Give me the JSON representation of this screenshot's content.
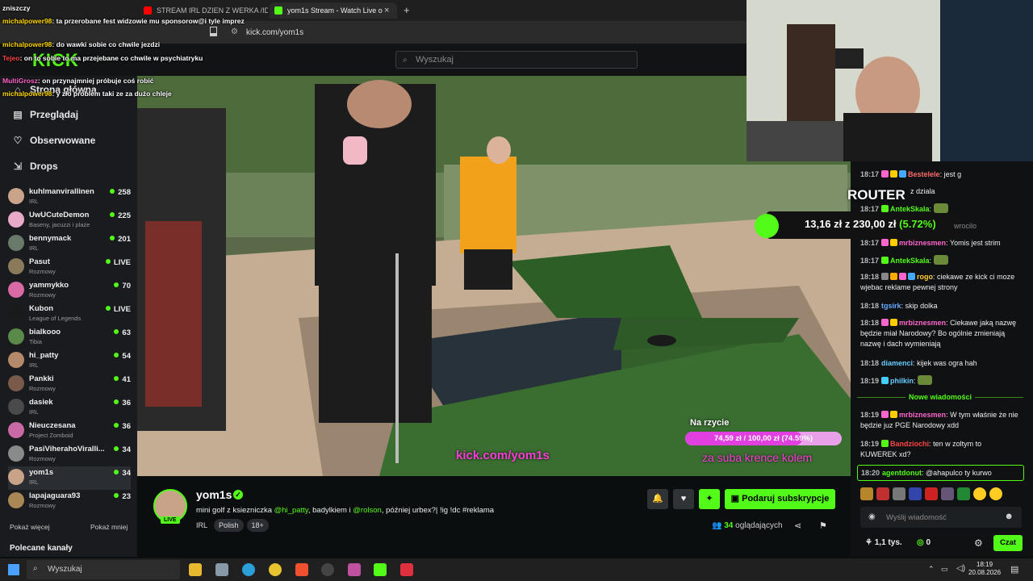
{
  "browser": {
    "tabs": [
      "STREAM IRL DZIEN Z WERKA /ID",
      "yom1s Stream - Watch Live o"
    ],
    "url": "kick.com/yom1s",
    "new_tab": "+",
    "close_tab": "×"
  },
  "header": {
    "logo": "KICK",
    "search_placeholder": "Wyszukaj"
  },
  "overlay_chat": [
    {
      "user": "",
      "text": "zniszczy"
    },
    {
      "user": "michalpower98",
      "text": "ta przerobane fest widzowie mu sponsorow@i tyle imprez"
    },
    {
      "user": "michalpower98",
      "text": "do wawki sobie co chwile jezdzi"
    },
    {
      "user": "Tejeo",
      "text": "on to sobie to ma przejebane co chwile w psychiatryku"
    },
    {
      "user": "MultiGrosz",
      "text": "on przynajmniej próbuje coś robić"
    },
    {
      "user": "michalpower98",
      "text": "y zło problem taki ze za dużo chleje"
    }
  ],
  "sidebar": {
    "nav": [
      "Strona główna",
      "Przeglądaj",
      "Obserwowane",
      "Drops"
    ],
    "channels": [
      {
        "name": "kuhlmanvirallinen",
        "category": "IRL",
        "viewers": "258"
      },
      {
        "name": "UwUCuteDemon",
        "category": "Baseny, jacuzzi i plaże",
        "viewers": "225"
      },
      {
        "name": "bennymack",
        "category": "IRL",
        "viewers": "201"
      },
      {
        "name": "Pasut",
        "category": "Rozmowy",
        "viewers": "LIVE"
      },
      {
        "name": "yammykko",
        "category": "Rozmowy",
        "viewers": "70"
      },
      {
        "name": "Kubon",
        "category": "League of Legends",
        "viewers": "LIVE"
      },
      {
        "name": "bialkooo",
        "category": "Tibia",
        "viewers": "63"
      },
      {
        "name": "hi_patty",
        "category": "IRL",
        "viewers": "54"
      },
      {
        "name": "Pankki",
        "category": "Rozmowy",
        "viewers": "41"
      },
      {
        "name": "dasiek",
        "category": "IRL",
        "viewers": "36"
      },
      {
        "name": "Nieuczesana",
        "category": "Project Zomboid",
        "viewers": "36"
      },
      {
        "name": "PasiViherahoViralli...",
        "category": "Rozmowy",
        "viewers": "34"
      },
      {
        "name": "yom1s",
        "category": "IRL",
        "viewers": "34"
      },
      {
        "name": "lapajaguara93",
        "category": "Rozmowy",
        "viewers": "23"
      }
    ],
    "show_more": "Pokaż więcej",
    "show_less": "Pokaż mniej",
    "recommended": "Polecane kanały"
  },
  "video_overlay": {
    "router_label": "ROUTER",
    "donation_amount": "13,16 zł",
    "donation_goal": "230,00 zł",
    "donation_pct": "(5.72%)",
    "donation_sep": "z",
    "goal_title": "Na rzycie",
    "goal_text": "74,59 zł  /  100,00 zł  (74.59%)",
    "goal_fraction": 0.7459,
    "goal_caption": "za suba krence kolem",
    "kick_url": "kick.com/yom1s"
  },
  "stream": {
    "name": "yom1s",
    "live": "LIVE",
    "title_parts": [
      "mini golf z ksiezniczka ",
      "@hi_patty",
      ", badylkiem i ",
      "@rolson",
      ", później urbex?| !ig !dc #reklama"
    ],
    "tags": [
      "IRL",
      "Polish",
      "18+"
    ],
    "subscribe_label": "Podaruj subskrypcje",
    "viewers": "34",
    "viewers_label": "oglądających"
  },
  "chat": {
    "messages": [
      {
        "time": "18:17",
        "user": "Bestelele",
        "color": "#ff6b6b",
        "text": "jest g"
      },
      {
        "time": "",
        "user": "",
        "color": "#eeeeee",
        "text": "z dziala"
      },
      {
        "time": "18:17",
        "user": "AntekSkala",
        "color": "#53fc18",
        "text": ""
      },
      {
        "time": "",
        "user": "",
        "color": "#eeeeee",
        "text": "wrocilo"
      },
      {
        "time": "18:17",
        "user": "mrbiznesmen",
        "color": "#ff66cc",
        "text": "Yomis jest strim"
      },
      {
        "time": "18:17",
        "user": "AntekSkala",
        "color": "#53fc18",
        "text": ""
      },
      {
        "time": "18:18",
        "user": "rogo",
        "color": "#ffcc33",
        "text": "ciekawe ze kick ci moze wjebac reklame pewnej strony"
      },
      {
        "time": "18:18",
        "user": "tgsirk",
        "color": "#66aaff",
        "text": "skip dolka"
      },
      {
        "time": "18:18",
        "user": "mrbiznesmen",
        "color": "#ff66cc",
        "text": "Ciekawe jaką nazwę będzie miał Narodowy? Bo ogólnie zmieniają nazwę i dach wymieniają"
      },
      {
        "time": "18:18",
        "user": "diamenci",
        "color": "#66ccff",
        "text": "kijek was ogra hah"
      },
      {
        "time": "18:19",
        "user": "philkin",
        "color": "#66ccff",
        "text": ""
      },
      {
        "time": "18:19",
        "user": "mrbiznesmen",
        "color": "#ff66cc",
        "text": "W tym właśnie że nie będzie juz PGE Narodowy xdd"
      },
      {
        "time": "18:19",
        "user": "Bandziochi",
        "color": "#ff4444",
        "text": "ten w zoltym to KUWEREK xd?"
      }
    ],
    "new_messages": "Nowe wiadomości",
    "pinned": {
      "time": "18:20",
      "user": "agentdonut",
      "text": "@ahapulco ty kurwo"
    },
    "input_placeholder": "Wyślij wiadomość",
    "points": "1,1 tys.",
    "zero": "0",
    "send_label": "Czat"
  },
  "taskbar": {
    "search": "Wyszukaj",
    "time": "18:19",
    "date": "20.08.2026"
  }
}
